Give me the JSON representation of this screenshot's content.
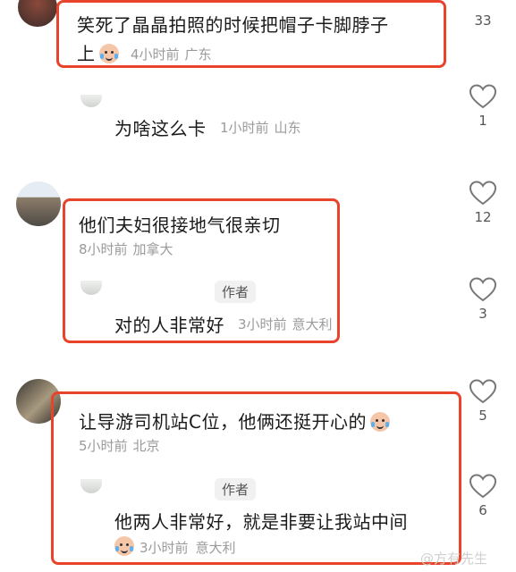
{
  "comments": [
    {
      "text_line1": "笑死了晶晶拍照的时候把帽子卡脚脖子",
      "text_line2": "上",
      "time": "4小时前",
      "location": "广东",
      "likes": "33"
    },
    {
      "text": "为啥这么卡",
      "time": "1小时前",
      "location": "山东",
      "likes": "1"
    },
    {
      "text": "他们夫妇很接地气很亲切",
      "time": "8小时前",
      "location": "加拿大",
      "likes": "12",
      "reply": {
        "badge": "作者",
        "text": "对的人非常好",
        "time": "3小时前",
        "location": "意大利",
        "likes": "3"
      }
    },
    {
      "text": "让导游司机站C位，他俩还挺开心的",
      "time": "5小时前",
      "location": "北京",
      "likes": "5",
      "reply": {
        "badge": "作者",
        "text": "他两人非常好，就是非要让我站中间",
        "time": "3小时前",
        "location": "意大利",
        "likes": "6"
      }
    }
  ],
  "watermark": "@方有先生",
  "colors": {
    "highlight_box": "#e8432b",
    "meta_text": "#9a9a9a"
  },
  "icons": [
    "heart-outline-icon",
    "crying-laugh-emoji"
  ]
}
